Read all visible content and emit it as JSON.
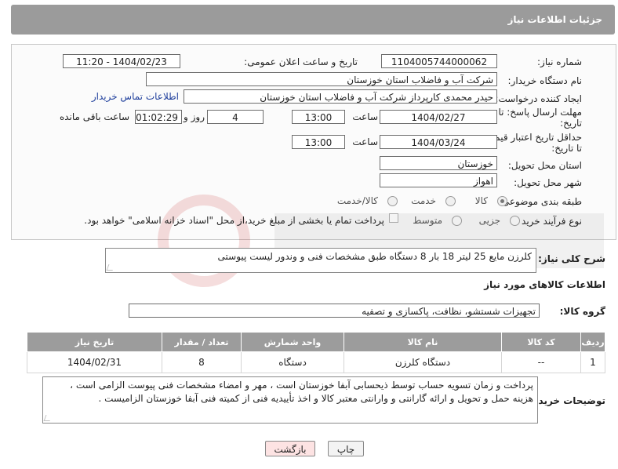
{
  "header": {
    "title": "جزئیات اطلاعات نیاز"
  },
  "form": {
    "need_number_label": "شماره نیاز:",
    "need_number": "1104005744000062",
    "announce_label": "تاریخ و ساعت اعلان عمومی:",
    "announce_value": "1404/02/23 - 11:20",
    "buyer_org_label": "نام دستگاه خریدار:",
    "buyer_org": "شرکت آب و فاضلاب استان خوزستان",
    "requester_label": "ایجاد کننده درخواست:",
    "requester": "حیدر محمدی کارپرداز شرکت آب و فاضلاب استان خوزستان",
    "contact_link": "اطلاعات تماس خریدار",
    "deadline_label_1": "مهلت ارسال پاسخ: تا",
    "deadline_label_2": "تاریخ:",
    "deadline_date": "1404/02/27",
    "time_label": "ساعت",
    "deadline_time": "13:00",
    "days_value": "4",
    "days_label": "روز و",
    "remaining_time": "01:02:29",
    "remaining_label": "ساعت باقی مانده",
    "min_valid_label_1": "حداقل تاریخ اعتبار قیمت:",
    "min_valid_label_2": "تا تاریخ:",
    "valid_date": "1404/03/24",
    "valid_time": "13:00",
    "province_label": "استان محل تحویل:",
    "province": "خوزستان",
    "city_label": "شهر محل تحویل:",
    "city": "اهواز",
    "category_label": "طبقه بندی موضوعی:",
    "category_options": [
      "کالا",
      "خدمت",
      "کالا/خدمت"
    ],
    "process_label": "نوع فرآیند خرید :",
    "process_options": [
      "جزیی",
      "متوسط"
    ],
    "payment_note": "پرداخت تمام یا بخشی از مبلغ خرید،از محل \"اسناد خزانه اسلامی\" خواهد بود."
  },
  "summary": {
    "label": "شرح کلی نیاز:",
    "text": "کلرزن مایع 25 لیتر 18 بار 8 دستگاه طبق مشخصات فنی و وندور لیست پیوستی"
  },
  "goods": {
    "section_title": "اطلاعات کالاهای مورد نیاز",
    "group_label": "گروه کالا:",
    "group_value": "تجهیزات شستشو، نظافت، پاکسازی و تصفیه",
    "columns": [
      "ردیف",
      "کد کالا",
      "نام کالا",
      "واحد شمارش",
      "تعداد / مقدار",
      "تاریخ نیاز"
    ],
    "rows": [
      [
        "1",
        "--",
        "دستگاه کلرزن",
        "دستگاه",
        "8",
        "1404/02/31"
      ]
    ]
  },
  "buyer_notes": {
    "label": "توضیحات خریدار:",
    "text": "پرداخت و زمان تسویه حساب توسط ذیحسابی آبفا خوزستان است ، مهر و امضاء مشخصات فنی پیوست الزامی است ، هزینه حمل و تحویل و ارائه گارانتی و وارانتی معتبر کالا و اخذ تأییدیه فنی از کمیته فنی آبفا خوزستان الزامیست ."
  },
  "buttons": {
    "print": "چاپ",
    "back": "بازگشت"
  },
  "colors": {
    "header_bg": "#9b9b9b",
    "back_button_bg": "#fde3e3",
    "link": "#1f3f9c"
  }
}
